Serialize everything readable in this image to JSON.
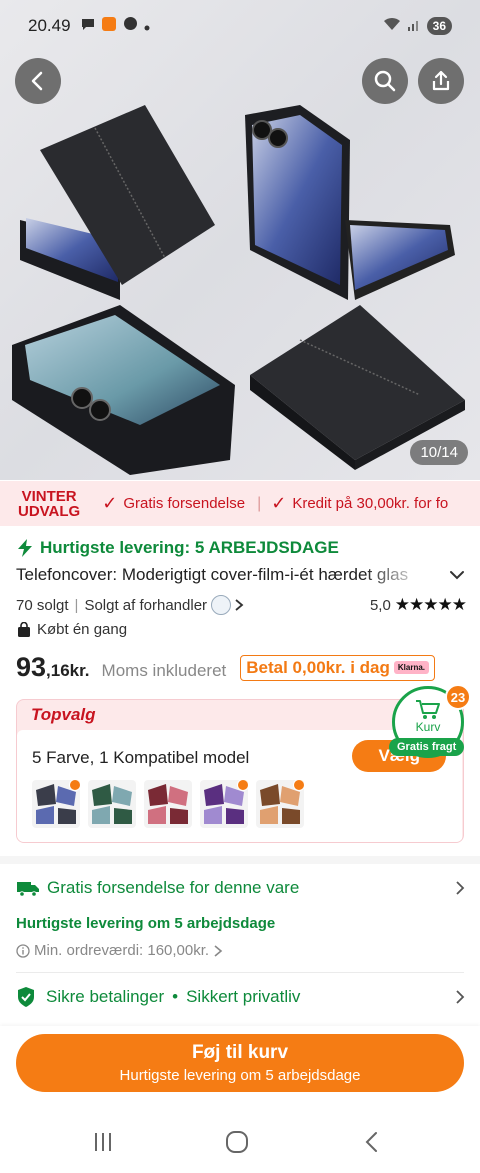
{
  "status_bar": {
    "time": "20.49",
    "battery": "36"
  },
  "hero": {
    "image_counter": "10/14",
    "image_alt": "Black leather phone covers on a foldable phone"
  },
  "promo": {
    "badge_line1": "VINTER",
    "badge_line2": "UDVALG",
    "items": [
      "Gratis forsendelse",
      "Kredit på 30,00kr. for fo"
    ]
  },
  "product": {
    "fast_delivery": "Hurtigste levering: 5 ARBEJDSDAGE",
    "title": "Telefoncover: Moderigtigt cover-film-i-ét hærdet glas",
    "sold": "70 solgt",
    "seller": "Solgt af forhandler",
    "rating_value": "5,0",
    "stars": "★★★★★",
    "bought_once": "Købt én gang",
    "price_main": "93",
    "price_cents": ",16kr.",
    "price_tax": "Moms inkluderet",
    "klarna_text": "Betal 0,00kr. i dag",
    "klarna_logo": "Klarna."
  },
  "topvalg": {
    "title": "Topvalg",
    "variant_summary": "5 Farve, 1 Kompatibel model",
    "choose_label": "Vælg",
    "swatch_colors": [
      "#3a3d4a",
      "#2f5a44",
      "#7a2a35",
      "#5a2f80",
      "#7a4a2a"
    ]
  },
  "cart": {
    "label": "Kurv",
    "count": "23",
    "free_tag": "Gratis fragt"
  },
  "shipping": {
    "title": "Gratis forsendelse for denne vare",
    "sub": "Hurtigste levering om 5 arbejdsdage",
    "min_order": "Min. ordreværdi: 160,00kr."
  },
  "security": {
    "label1": "Sikre betalinger",
    "dot": "•",
    "label2": "Sikkert privatliv"
  },
  "cta": {
    "main": "Føj til kurv",
    "sub": "Hurtigste levering om 5 arbejdsdage"
  },
  "colors": {
    "green": "#0e8a3b",
    "orange": "#f57c14",
    "red": "#c81420"
  }
}
